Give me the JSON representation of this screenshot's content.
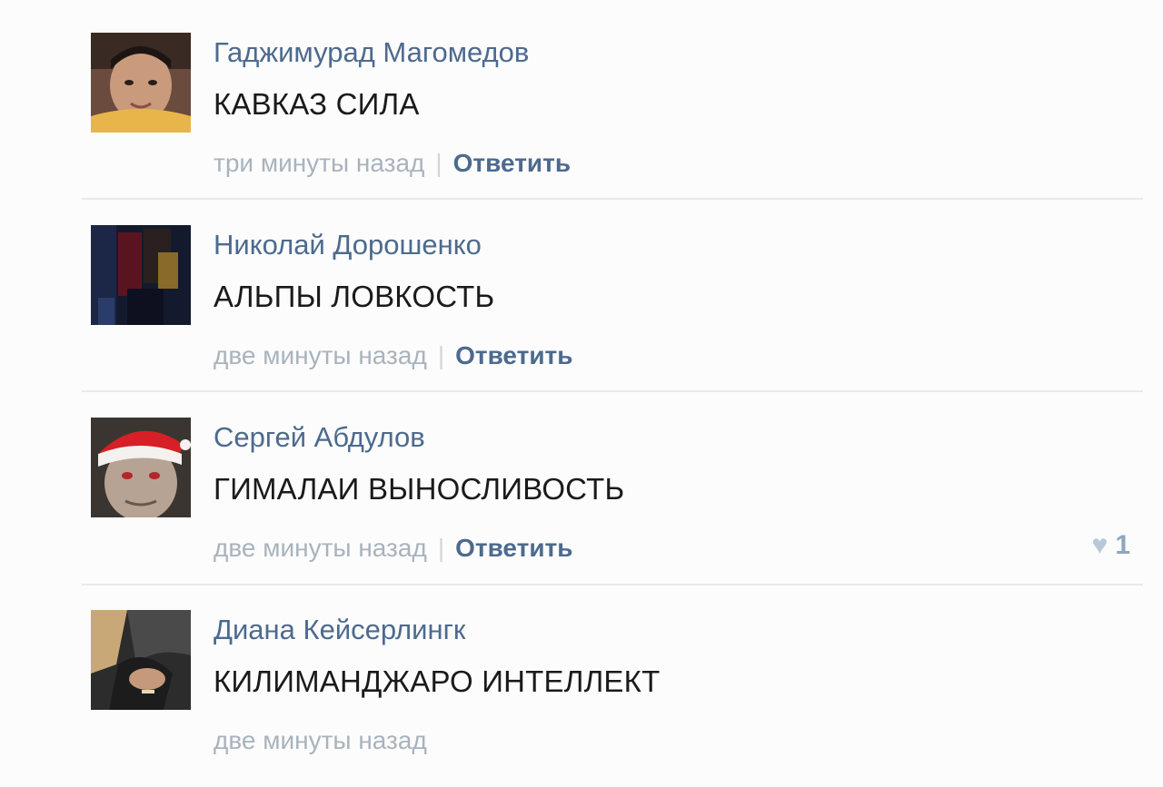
{
  "comments": [
    {
      "author": "Гаджимурад Магомедов",
      "text": "КАВКАЗ СИЛА",
      "time": "три минуты назад",
      "separator": "|",
      "reply": "Ответить"
    },
    {
      "author": "Николай Дорошенко",
      "text": "АЛЬПЫ ЛОВКОСТЬ",
      "time": "две минуты назад",
      "separator": "|",
      "reply": "Ответить"
    },
    {
      "author": "Сергей Абдулов",
      "text": "ГИМАЛАИ ВЫНОСЛИВОСТЬ",
      "time": "две минуты назад",
      "separator": "|",
      "reply": "Ответить",
      "likes": "1",
      "like_icon": "heart-icon"
    },
    {
      "author": "Диана Кейсерлингк",
      "text": "КИЛИМАНДЖАРО ИНТЕЛЛЕКТ",
      "time": "две минуты назад"
    }
  ],
  "colors": {
    "author_link": "#4d6a8e",
    "timestamp": "#a9b3bd",
    "comment_text": "#1a1a1a",
    "like": "#a9bed3"
  }
}
